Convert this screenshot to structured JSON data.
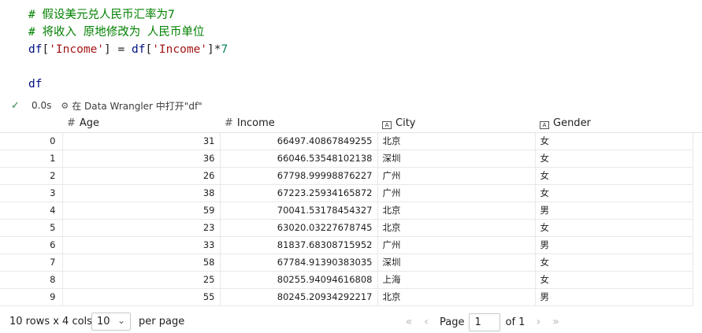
{
  "code": {
    "line1": "# 假设美元兑人民币汇率为7",
    "line2": "# 将收入 原地修改为 人民币单位",
    "line3_parts": [
      "df",
      "[",
      "'Income'",
      "]",
      " = ",
      "df",
      "[",
      "'Income'",
      "]",
      "*",
      "7"
    ],
    "line5": "df"
  },
  "status": {
    "time": "0.0s",
    "data_wrangler": "在 Data Wrangler 中打开\"df\""
  },
  "table": {
    "columns": [
      {
        "name": "Age",
        "type_icon": "hash-icon"
      },
      {
        "name": "Income",
        "type_icon": "hash-icon"
      },
      {
        "name": "City",
        "type_icon": "text-type-icon"
      },
      {
        "name": "Gender",
        "type_icon": "text-type-icon"
      }
    ],
    "rows": [
      {
        "index": "0",
        "age": "31",
        "income": "66497.40867849255",
        "city": "北京",
        "gender": "女"
      },
      {
        "index": "1",
        "age": "36",
        "income": "66046.53548102138",
        "city": "深圳",
        "gender": "女"
      },
      {
        "index": "2",
        "age": "26",
        "income": "67798.99998876227",
        "city": "广州",
        "gender": "女"
      },
      {
        "index": "3",
        "age": "38",
        "income": "67223.25934165872",
        "city": "广州",
        "gender": "女"
      },
      {
        "index": "4",
        "age": "59",
        "income": "70041.53178454327",
        "city": "北京",
        "gender": "男"
      },
      {
        "index": "5",
        "age": "23",
        "income": "63020.03227678745",
        "city": "北京",
        "gender": "女"
      },
      {
        "index": "6",
        "age": "33",
        "income": "81837.68308715952",
        "city": "广州",
        "gender": "男"
      },
      {
        "index": "7",
        "age": "58",
        "income": "67784.91390383035",
        "city": "深圳",
        "gender": "女"
      },
      {
        "index": "8",
        "age": "25",
        "income": "80255.94094616808",
        "city": "上海",
        "gender": "女"
      },
      {
        "index": "9",
        "age": "55",
        "income": "80245.20934292217",
        "city": "北京",
        "gender": "男"
      }
    ]
  },
  "footer": {
    "rows_cols": "10 rows x 4 cols",
    "page_size": "10",
    "per_page": "per page",
    "page_label": "Page",
    "page_value": "1",
    "of_label": "of 1"
  }
}
